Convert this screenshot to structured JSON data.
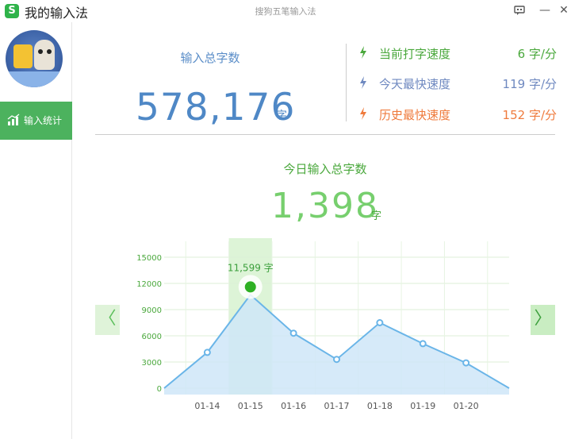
{
  "window": {
    "logo_letter": "S",
    "title": "我的输入法",
    "subtitle": "搜狗五笔输入法",
    "feedback_icon": "feedback-icon",
    "minimize_symbol": "—",
    "close_symbol": "✕"
  },
  "sidebar": {
    "avatar_icon": "avatar",
    "items": [
      {
        "label": "输入统计",
        "icon": "bar-chart-icon",
        "active": true
      }
    ]
  },
  "summary": {
    "total_label": "输入总字数",
    "total_value": "578,176",
    "total_unit": "字",
    "speeds": [
      {
        "label": "当前打字速度",
        "value": "6 字/分",
        "color": "#4aa83c",
        "icon": "lightning-icon"
      },
      {
        "label": "今天最快速度",
        "value": "119 字/分",
        "color": "#6f89c0",
        "icon": "lightning-icon"
      },
      {
        "label": "历史最快速度",
        "value": "152 字/分",
        "color": "#ef7b3d",
        "icon": "lightning-icon"
      }
    ]
  },
  "today": {
    "label": "今日输入总字数",
    "value": "1,398",
    "unit": "字"
  },
  "navigation": {
    "prev_symbol": "〈",
    "next_symbol": "〉"
  },
  "colors": {
    "accent_green": "#4cb25e",
    "chart_line": "#6ab5e8",
    "chart_fill": "#cfe6f8",
    "highlight_column": "#d2f0c9",
    "highlight_point": "#2db022"
  },
  "chart_data": {
    "type": "area",
    "categories": [
      "01-14",
      "01-15",
      "01-16",
      "01-17",
      "01-18",
      "01-19",
      "01-20"
    ],
    "values": [
      4100,
      10700,
      6300,
      3300,
      7500,
      5100,
      2900
    ],
    "start_value": 0,
    "end_value": 0,
    "ylim": [
      0,
      15000
    ],
    "yticks": [
      0,
      3000,
      6000,
      9000,
      12000,
      15000
    ],
    "highlight": {
      "category": "01-15",
      "value": 11599,
      "label": "11,599 字"
    },
    "grid": true,
    "legend": "none"
  }
}
